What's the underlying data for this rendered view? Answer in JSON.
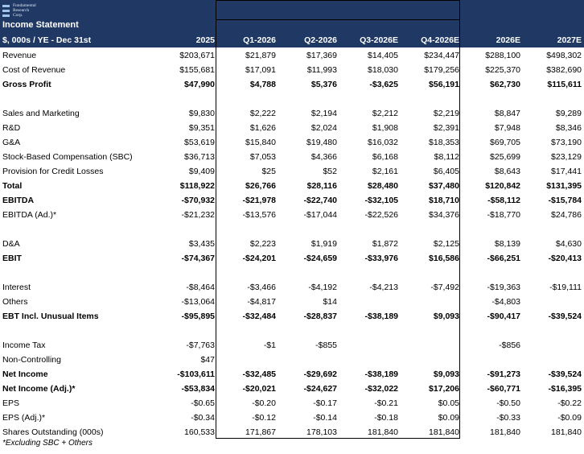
{
  "logo": {
    "lines": [
      "Fundamental",
      "Research",
      "Corp."
    ]
  },
  "title": "Income Statement",
  "header": {
    "label": "$, 000s / YE - Dec 31st",
    "columns": [
      "2025",
      "Q1-2026",
      "Q2-2026",
      "Q3-2026E",
      "Q4-2026E",
      "2026E",
      "2027E"
    ]
  },
  "rows": [
    {
      "label": "Revenue",
      "bold": false,
      "values": [
        "$203,671",
        "$21,879",
        "$17,369",
        "$14,405",
        "$234,447",
        "$288,100",
        "$498,302"
      ]
    },
    {
      "label": "Cost of Revenue",
      "bold": false,
      "values": [
        "$155,681",
        "$17,091",
        "$11,993",
        "$18,030",
        "$179,256",
        "$225,370",
        "$382,690"
      ]
    },
    {
      "label": "Gross Profit",
      "bold": true,
      "values": [
        "$47,990",
        "$4,788",
        "$5,376",
        "-$3,625",
        "$56,191",
        "$62,730",
        "$115,611"
      ]
    },
    {
      "spacer": true
    },
    {
      "label": "Sales and Marketing",
      "bold": false,
      "values": [
        "$9,830",
        "$2,222",
        "$2,194",
        "$2,212",
        "$2,219",
        "$8,847",
        "$9,289"
      ]
    },
    {
      "label": "R&D",
      "bold": false,
      "values": [
        "$9,351",
        "$1,626",
        "$2,024",
        "$1,908",
        "$2,391",
        "$7,948",
        "$8,346"
      ]
    },
    {
      "label": "G&A",
      "bold": false,
      "values": [
        "$53,619",
        "$15,840",
        "$19,480",
        "$16,032",
        "$18,353",
        "$69,705",
        "$73,190"
      ]
    },
    {
      "label": "Stock-Based Compensation (SBC)",
      "bold": false,
      "values": [
        "$36,713",
        "$7,053",
        "$4,366",
        "$6,168",
        "$8,112",
        "$25,699",
        "$23,129"
      ]
    },
    {
      "label": "Provision for Credit Losses",
      "bold": false,
      "values": [
        "$9,409",
        "$25",
        "$52",
        "$2,161",
        "$6,405",
        "$8,643",
        "$17,441"
      ]
    },
    {
      "label": "Total",
      "bold": true,
      "values": [
        "$118,922",
        "$26,766",
        "$28,116",
        "$28,480",
        "$37,480",
        "$120,842",
        "$131,395"
      ]
    },
    {
      "label": "EBITDA",
      "bold": true,
      "values": [
        "-$70,932",
        "-$21,978",
        "-$22,740",
        "-$32,105",
        "$18,710",
        "-$58,112",
        "-$15,784"
      ]
    },
    {
      "label": "EBITDA (Ad.)*",
      "bold": false,
      "values": [
        "-$21,232",
        "-$13,576",
        "-$17,044",
        "-$22,526",
        "$34,376",
        "-$18,770",
        "$24,786"
      ]
    },
    {
      "spacer": true
    },
    {
      "label": "D&A",
      "bold": false,
      "values": [
        "$3,435",
        "$2,223",
        "$1,919",
        "$1,872",
        "$2,125",
        "$8,139",
        "$4,630"
      ]
    },
    {
      "label": "EBIT",
      "bold": true,
      "values": [
        "-$74,367",
        "-$24,201",
        "-$24,659",
        "-$33,976",
        "$16,586",
        "-$66,251",
        "-$20,413"
      ]
    },
    {
      "spacer": true
    },
    {
      "label": "Interest",
      "bold": false,
      "values": [
        "-$8,464",
        "-$3,466",
        "-$4,192",
        "-$4,213",
        "-$7,492",
        "-$19,363",
        "-$19,111"
      ]
    },
    {
      "label": "Others",
      "bold": false,
      "values": [
        "-$13,064",
        "-$4,817",
        "$14",
        "",
        "",
        "-$4,803",
        ""
      ]
    },
    {
      "label": "EBT Incl. Unusual Items",
      "bold": true,
      "values": [
        "-$95,895",
        "-$32,484",
        "-$28,837",
        "-$38,189",
        "$9,093",
        "-$90,417",
        "-$39,524"
      ]
    },
    {
      "spacer": true
    },
    {
      "label": "Income Tax",
      "bold": false,
      "values": [
        "-$7,763",
        "-$1",
        "-$855",
        "",
        "",
        "-$856",
        ""
      ]
    },
    {
      "label": "Non-Controlling",
      "bold": false,
      "values": [
        "$47",
        "",
        "",
        "",
        "",
        "",
        ""
      ]
    },
    {
      "label": "Net Income",
      "bold": true,
      "values": [
        "-$103,611",
        "-$32,485",
        "-$29,692",
        "-$38,189",
        "$9,093",
        "-$91,273",
        "-$39,524"
      ]
    },
    {
      "label": "Net Income (Adj.)*",
      "bold": true,
      "values": [
        "-$53,834",
        "-$20,021",
        "-$24,627",
        "-$32,022",
        "$17,206",
        "-$60,771",
        "-$16,395"
      ]
    },
    {
      "label": "EPS",
      "bold": false,
      "values": [
        "-$0.65",
        "-$0.20",
        "-$0.17",
        "-$0.21",
        "$0.05",
        "-$0.50",
        "-$0.22"
      ]
    },
    {
      "label": "EPS (Adj.)*",
      "bold": false,
      "values": [
        "-$0.34",
        "-$0.12",
        "-$0.14",
        "-$0.18",
        "$0.09",
        "-$0.33",
        "-$0.09"
      ]
    },
    {
      "label": "Shares Outstanding (000s)",
      "bold": false,
      "values": [
        "160,533",
        "171,867",
        "178,103",
        "181,840",
        "181,840",
        "181,840",
        "181,840"
      ]
    }
  ],
  "footnote": "*Excluding SBC + Others"
}
